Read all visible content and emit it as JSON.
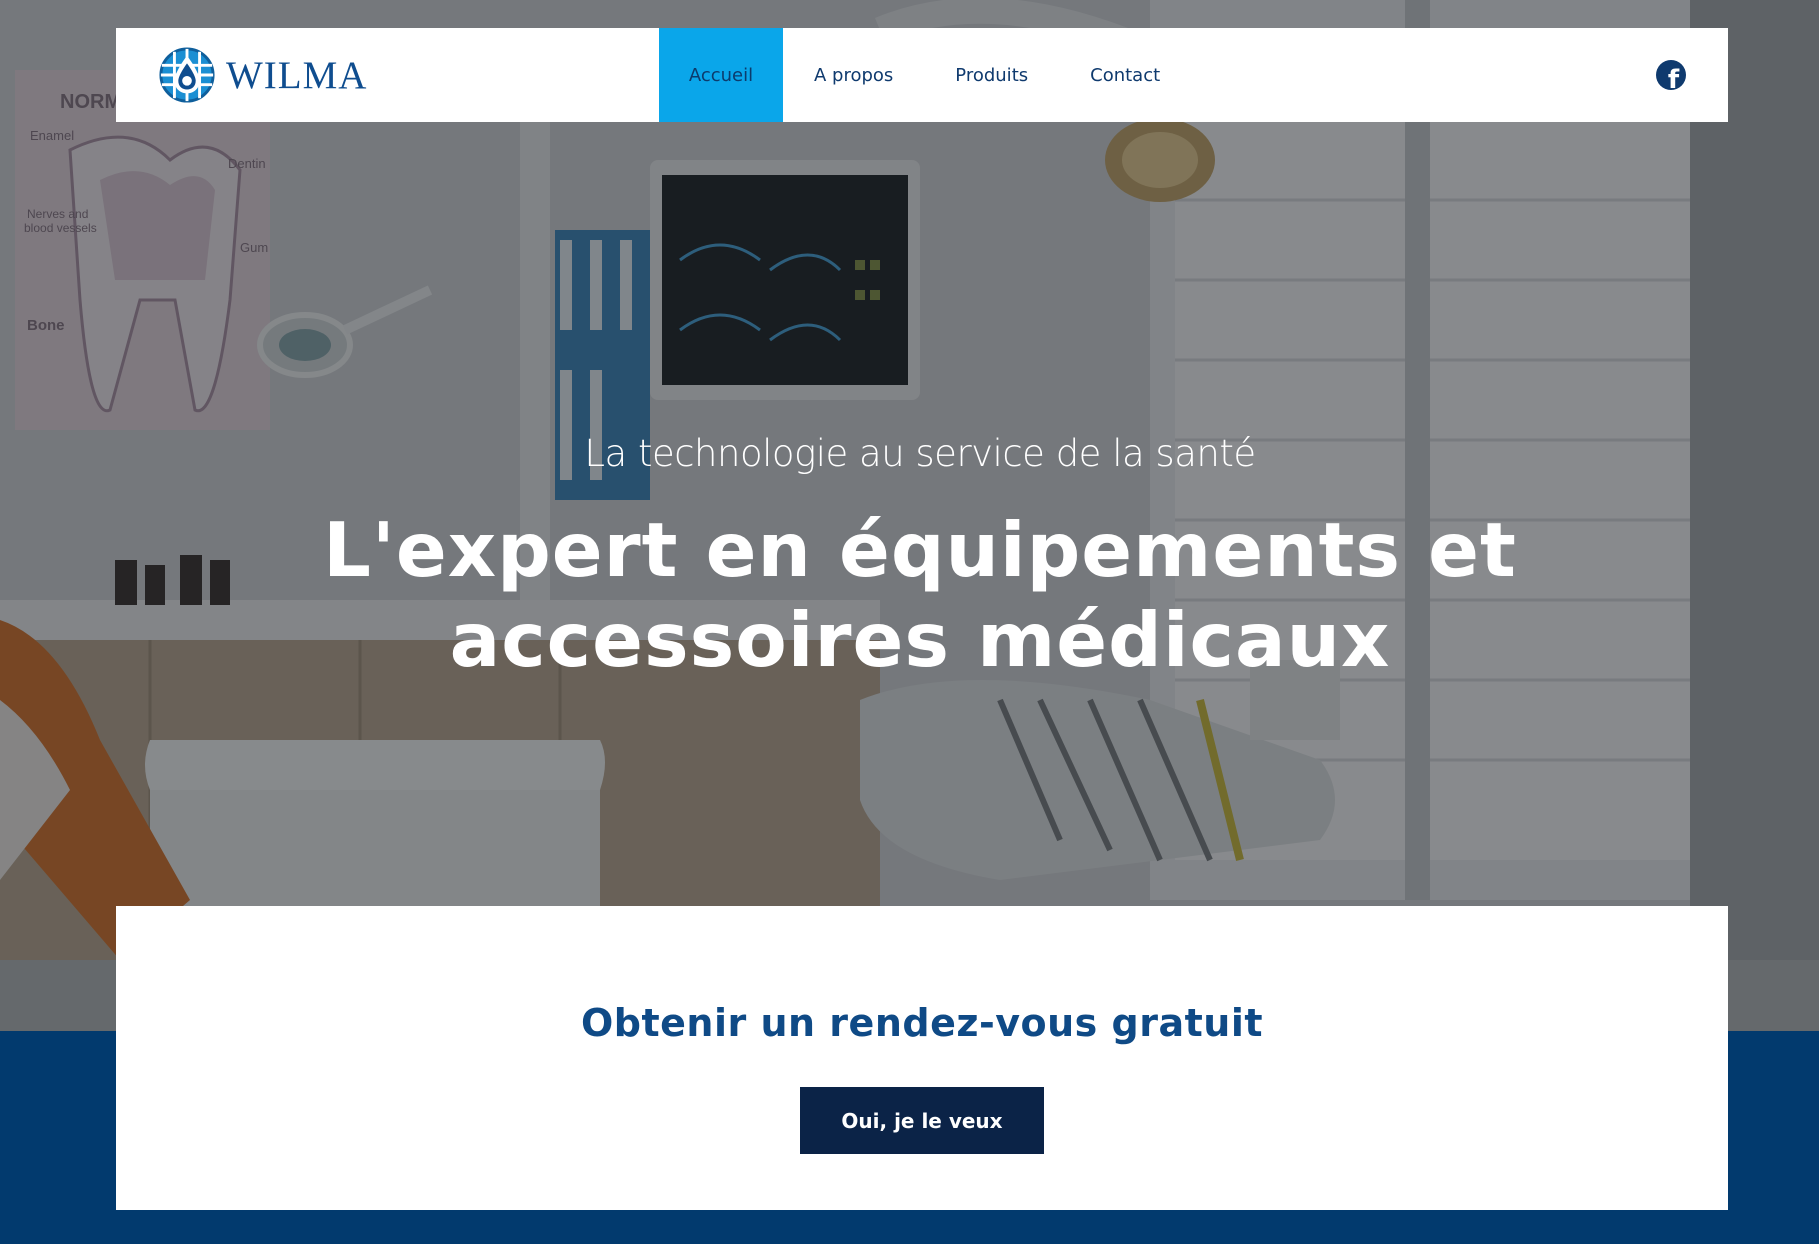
{
  "brand": {
    "name": "WILMA"
  },
  "nav": {
    "items": [
      {
        "label": "Accueil",
        "active": true
      },
      {
        "label": "A propos",
        "active": false
      },
      {
        "label": "Produits",
        "active": false
      },
      {
        "label": "Contact",
        "active": false
      }
    ],
    "social_icon": "facebook-icon"
  },
  "hero": {
    "tagline": "La technologie au service de la santé",
    "headline_line1": "L'expert en équipements et",
    "headline_line2": "accessoires médicaux",
    "poster_labels": [
      "NORM",
      "Enamel",
      "Dentin",
      "Nerves and",
      "blood vessels",
      "Gum",
      "Bone"
    ]
  },
  "cta": {
    "title": "Obtenir un rendez-vous gratuit",
    "button_label": "Oui, je le veux"
  },
  "colors": {
    "active_nav": "#0aa6ea",
    "brand_blue": "#0f4a86",
    "footer_band": "#023a6e",
    "button_bg": "#0b2347"
  }
}
